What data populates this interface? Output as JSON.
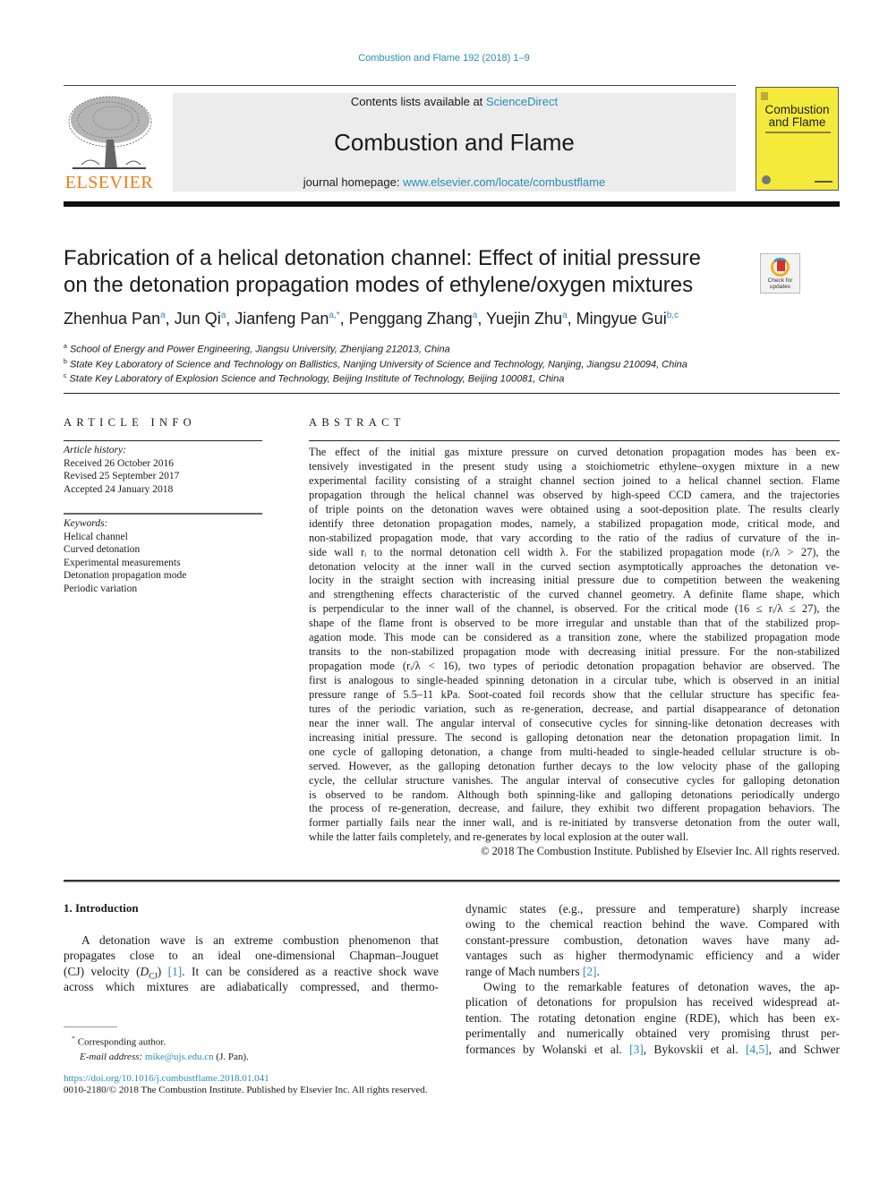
{
  "header": {
    "journal_ref": "Combustion and Flame 192 (2018) 1–9",
    "contents_prefix": "Contents lists available at ",
    "contents_link": "ScienceDirect",
    "journal_name": "Combustion and Flame",
    "homepage_prefix": "journal homepage: ",
    "homepage_link": "www.elsevier.com/locate/combustflame",
    "publisher_logo_text": "ELSEVIER",
    "cover_title_line1": "Combustion",
    "cover_title_line2": "and Flame",
    "colors": {
      "link": "#2a8bb5",
      "elsevier_orange": "#f07c13",
      "cover_yellow": "#f4ea3a",
      "band_gray": "#ececec"
    }
  },
  "article": {
    "title_line1": "Fabrication of a helical detonation channel: Effect of initial pressure",
    "title_line2": "on the detonation propagation modes of ethylene/oxygen mixtures",
    "check_updates_line1": "Check for",
    "check_updates_line2": "updates",
    "authors": [
      {
        "name": "Zhenhua Pan",
        "aff": "a"
      },
      {
        "name": "Jun Qi",
        "aff": "a"
      },
      {
        "name": "Jianfeng Pan",
        "aff": "a,*"
      },
      {
        "name": "Penggang Zhang",
        "aff": "a"
      },
      {
        "name": "Yuejin Zhu",
        "aff": "a"
      },
      {
        "name": "Mingyue Gui",
        "aff": "b,c"
      }
    ],
    "affiliations": [
      {
        "mark": "a",
        "text": "School of Energy and Power Engineering, Jiangsu University, Zhenjiang 212013, China"
      },
      {
        "mark": "b",
        "text": "State Key Laboratory of Science and Technology on Ballistics, Nanjing University of Science and Technology, Nanjing, Jiangsu 210094, China"
      },
      {
        "mark": "c",
        "text": "State Key Laboratory of Explosion Science and Technology, Beijing Institute of Technology, Beijing 100081, China"
      }
    ]
  },
  "article_info": {
    "heading": "ARTICLE INFO",
    "history_label": "Article history:",
    "history": [
      "Received 26 October 2016",
      "Revised 25 September 2017",
      "Accepted 24 January 2018"
    ],
    "keywords_label": "Keywords:",
    "keywords": [
      "Helical channel",
      "Curved detonation",
      "Experimental measurements",
      "Detonation propagation mode",
      "Periodic variation"
    ]
  },
  "abstract": {
    "heading": "ABSTRACT",
    "lines": [
      "The effect of the initial gas mixture pressure on curved detonation propagation modes has been ex-",
      "tensively investigated in the present study using a stoichiometric ethylene–oxygen mixture in a new",
      "experimental facility consisting of a straight channel section joined to a helical channel section. Flame",
      "propagation through the helical channel was observed by high-speed CCD camera, and the trajectories",
      "of triple points on the detonation waves were obtained using a soot-deposition plate. The results clearly",
      "identify three detonation propagation modes, namely, a stabilized propagation mode, critical mode, and",
      "non-stabilized propagation mode, that vary according to the ratio of the radius of curvature of the in-",
      "side wall rᵢ to the normal detonation cell width λ. For the stabilized propagation mode (rᵢ/λ > 27), the",
      "detonation velocity at the inner wall in the curved section asymptotically approaches the detonation ve-",
      "locity in the straight section with increasing initial pressure due to competition between the weakening",
      "and strengthening effects characteristic of the curved channel geometry. A definite flame shape, which",
      "is perpendicular to the inner wall of the channel, is observed. For the critical mode (16 ≤ rᵢ/λ ≤ 27), the",
      "shape of the flame front is observed to be more irregular and unstable than that of the stabilized prop-",
      "agation mode. This mode can be considered as a transition zone, where the stabilized propagation mode",
      "transits to the non-stabilized propagation mode with decreasing initial pressure. For the non-stabilized",
      "propagation mode (rᵢ/λ < 16), two types of periodic detonation propagation behavior are observed. The",
      "first is analogous to single-headed spinning detonation in a circular tube, which is observed in an initial",
      "pressure range of 5.5–11 kPa. Soot-coated foil records show that the cellular structure has specific fea-",
      "tures of the periodic variation, such as re-generation, decrease, and partial disappearance of detonation",
      "near the inner wall. The angular interval of consecutive cycles for sinning-like detonation decreases with",
      "increasing initial pressure. The second is galloping detonation near the detonation propagation limit. In",
      "one cycle of galloping detonation, a change from multi-headed to single-headed cellular structure is ob-",
      "served. However, as the galloping detonation further decays to the low velocity phase of the galloping",
      "cycle, the cellular structure vanishes. The angular interval of consecutive cycles for galloping detonation",
      "is observed to be random. Although both spinning-like and galloping detonations periodically undergo",
      "the process of re-generation, decrease, and failure, they exhibit two different propagation behaviors. The",
      "former partially fails near the inner wall, and is re-initiated by transverse detonation from the outer wall,",
      "while the latter fails completely, and re-generates by local explosion at the outer wall."
    ],
    "copyright": "© 2018 The Combustion Institute. Published by Elsevier Inc. All rights reserved."
  },
  "body": {
    "section_heading": "1. Introduction",
    "left_lines": [
      "A detonation wave is an extreme combustion phenomenon that",
      "propagates close to an ideal one-dimensional Chapman–Jouguet",
      "(CJ) velocity (D",
      "across which mixtures are adiabatically compressed, and thermo-"
    ],
    "left_line3": {
      "pre": "(CJ) velocity (",
      "sym": "D",
      "sub": "CJ",
      "mid": ") ",
      "ref": "[1]",
      "post": ". It can be considered as a reactive shock wave"
    },
    "right_lines": [
      {
        "pre": "dynamic states (e.g., pressure and temperature) sharply increase"
      },
      {
        "pre": "owing to the chemical reaction behind the wave. Compared with"
      },
      {
        "pre": "constant-pressure combustion, detonation waves have many ad-"
      },
      {
        "pre": "vantages such as higher thermodynamic efficiency and a wider"
      },
      {
        "pre": "range of Mach numbers ",
        "ref": "[2]",
        "post": "."
      },
      {
        "pre": "Owing to the remarkable features of detonation waves, the ap-"
      },
      {
        "pre": "plication of detonations for propulsion has received widespread at-"
      },
      {
        "pre": "tention. The rotating detonation engine (RDE), which has been ex-"
      },
      {
        "pre": "perimentally and numerically obtained very promising thrust per-"
      },
      {
        "pre": "formances by Wolanski et al. ",
        "ref": "[3]",
        "mid": ", Bykovskii et al. ",
        "ref2": "[4,5]",
        "post": ", and Schwer"
      }
    ]
  },
  "footnotes": {
    "corresponding_mark": "*",
    "corresponding_text": "Corresponding author.",
    "email_label": "E-mail address: ",
    "email": "mike@ujs.edu.cn",
    "email_suffix": " (J. Pan).",
    "doi": "https://doi.org/10.1016/j.combustflame.2018.01.041",
    "issn_line": "0010-2180/© 2018 The Combustion Institute. Published by Elsevier Inc. All rights reserved."
  }
}
